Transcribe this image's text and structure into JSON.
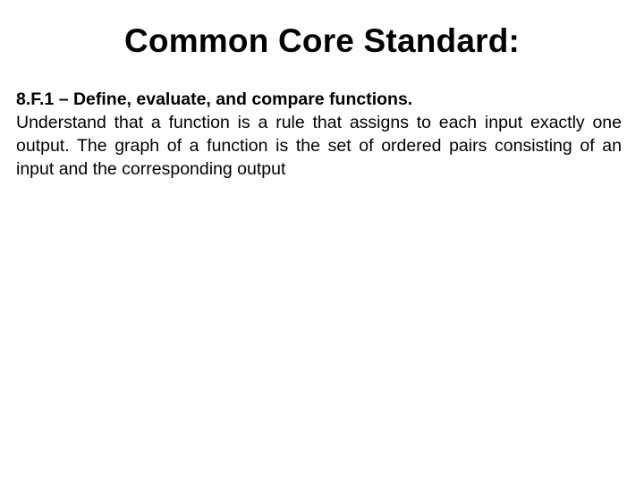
{
  "slide": {
    "title": "Common Core Standard:",
    "standard_heading": "8.F.1 – Define, evaluate, and compare functions.",
    "standard_text": "Understand that a function is a rule that assigns to each input exactly one output. The graph of a function is the set of ordered pairs consisting of an input and the corresponding output"
  }
}
